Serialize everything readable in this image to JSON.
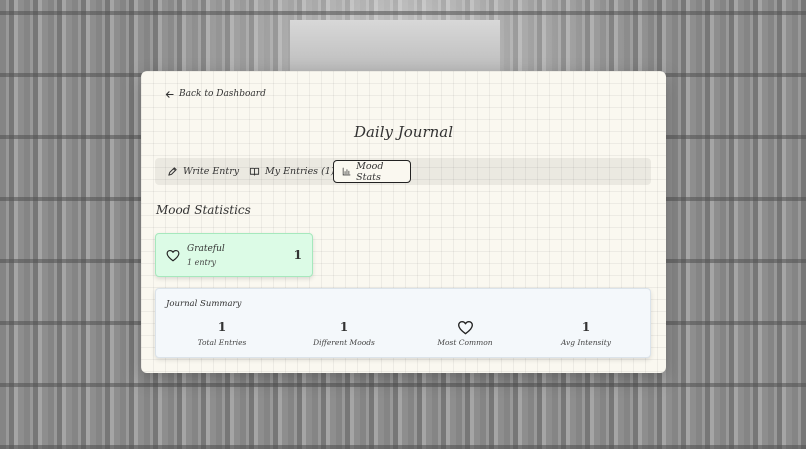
{
  "nav": {
    "back_label": "Back to Dashboard"
  },
  "page": {
    "title": "Daily Journal"
  },
  "tabs": [
    {
      "label": "Write Entry",
      "icon": "pen-icon",
      "active": false
    },
    {
      "label": "My Entries (1)",
      "icon": "book-icon",
      "active": false
    },
    {
      "label": "Mood Stats",
      "icon": "bar-chart-icon",
      "active": true
    }
  ],
  "mood_stats": {
    "title": "Mood Statistics",
    "moods": [
      {
        "name": "Grateful",
        "count_label": "1 entry",
        "count": "1",
        "icon": "heart-icon",
        "color": "#dcfbe6"
      }
    ]
  },
  "summary": {
    "title": "Journal Summary",
    "stats": [
      {
        "value": "1",
        "label": "Total Entries"
      },
      {
        "value": "1",
        "label": "Different Moods"
      },
      {
        "value": "",
        "icon": "heart-icon",
        "label": "Most Common"
      },
      {
        "value": "1",
        "label": "Avg Intensity"
      }
    ]
  },
  "colors": {
    "card_background": "#faf8f0",
    "mood_card_green": "#dcfbe6",
    "summary_background": "#f4f8fb",
    "text": "#333333"
  }
}
